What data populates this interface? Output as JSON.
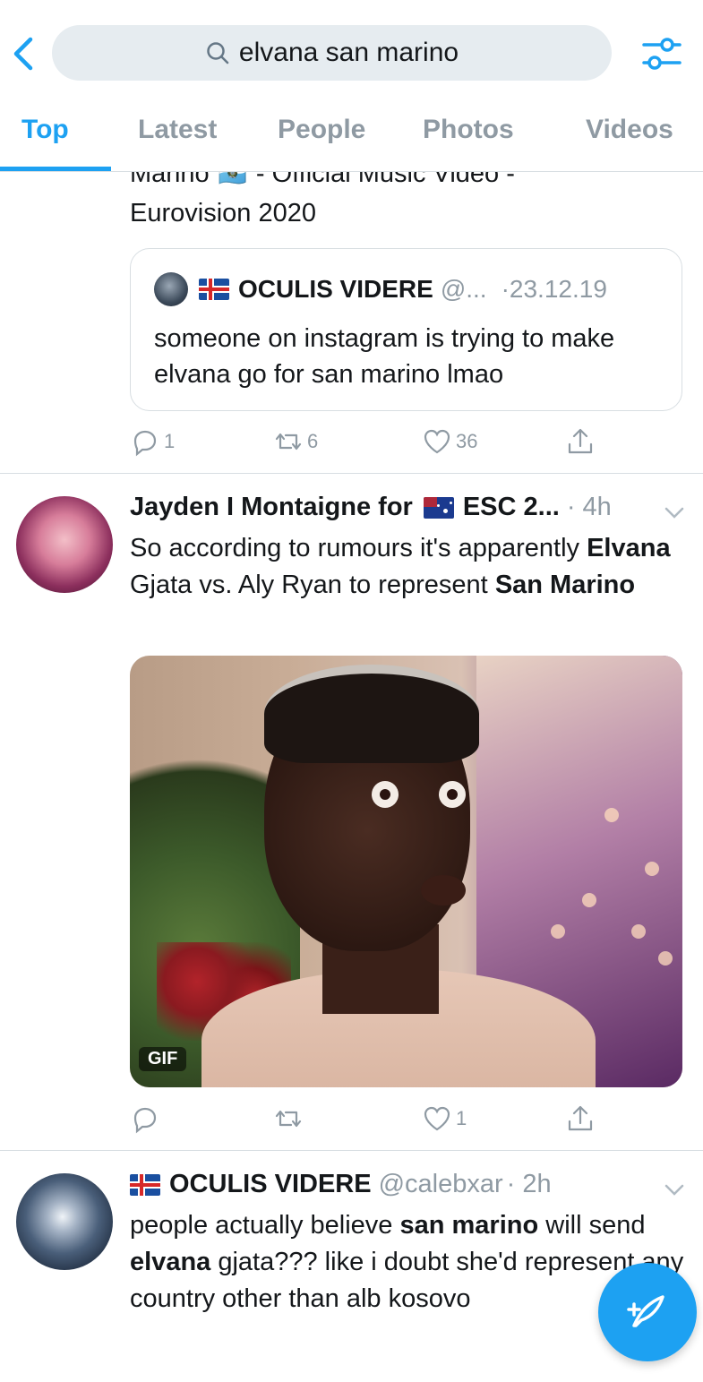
{
  "header": {
    "back_icon": "chevron-left-icon",
    "search_query": "elvana san marino",
    "filter_icon": "sliders-icon",
    "accent_color": "#1da1f2"
  },
  "tabs": [
    {
      "label": "Top",
      "active": true
    },
    {
      "label": "Latest",
      "active": false
    },
    {
      "label": "People",
      "active": false
    },
    {
      "label": "Photos",
      "active": false
    },
    {
      "label": "Videos",
      "active": false
    }
  ],
  "tweet1": {
    "title_cut": "Marino 🇸🇲 - Official Music Video -",
    "title_line2": "Eurovision 2020",
    "quote": {
      "name": "OCULIS VIDERE",
      "handle": "@...",
      "date": "·23.12.19",
      "text": "someone on instagram is trying to make elvana go for san marino lmao"
    },
    "reply_count": "1",
    "retweet_count": "6",
    "like_count": "36"
  },
  "tweet2": {
    "name": "Jayden I Montaigne for",
    "name_suffix": "ESC 2...",
    "time": "· 4h",
    "text_1": "So according to rumours it's apparently ",
    "text_b1": "Elvana",
    "text_2": " Gjata vs. Aly Ryan to represent ",
    "text_b2": "San Marino",
    "gif_label": "GIF",
    "reply_count": "",
    "retweet_count": "",
    "like_count": "1"
  },
  "tweet3": {
    "name": "OCULIS VIDERE",
    "handle": "@calebxar",
    "time": "· 2h",
    "text_1": "people actually believe ",
    "text_b1": "san marino",
    "text_2": " will send ",
    "text_b2": "elvana",
    "text_3": " gjata??? like i doubt she'd represent any country other than alb kosovo"
  },
  "fab": {
    "icon": "compose-feather-icon"
  }
}
